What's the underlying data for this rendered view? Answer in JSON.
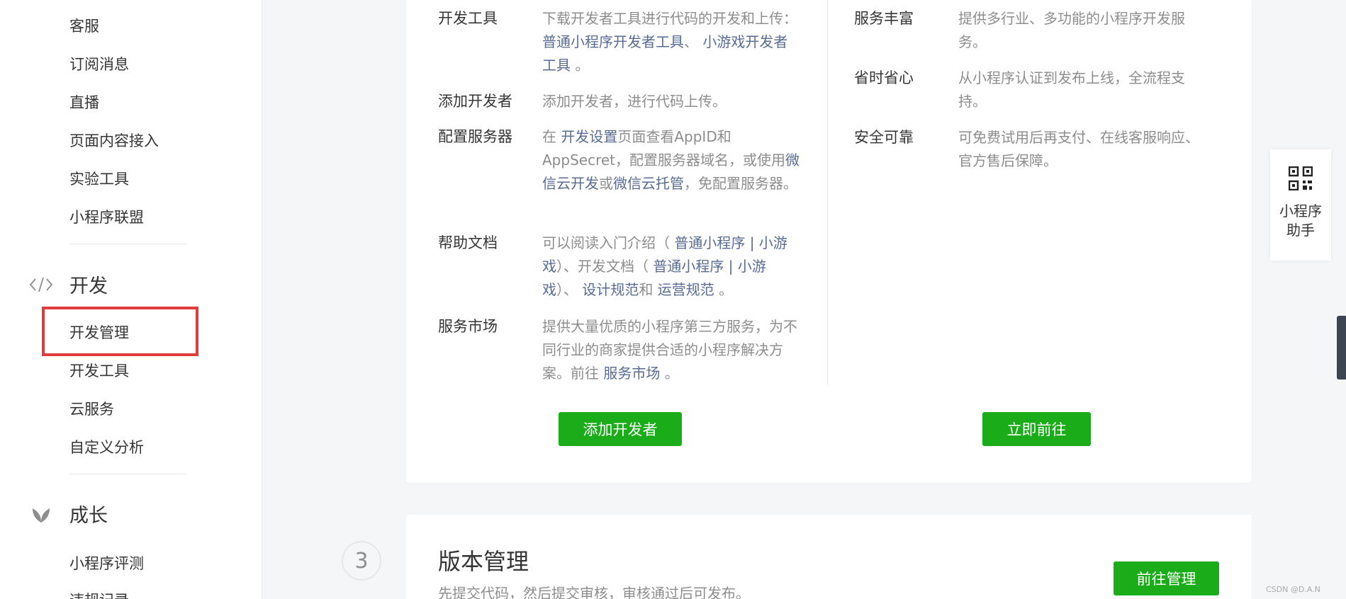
{
  "sidebar": {
    "items_top": [
      "客服",
      "订阅消息",
      "直播",
      "页面内容接入",
      "实验工具",
      "小程序联盟"
    ],
    "sections": [
      {
        "icon": "code-icon",
        "label": "开发",
        "items": [
          "开发管理",
          "开发工具",
          "云服务",
          "自定义分析"
        ]
      },
      {
        "icon": "leaf-icon",
        "label": "成长",
        "items": [
          "小程序评测",
          "违规记录"
        ]
      }
    ]
  },
  "left_rows": [
    {
      "label": "开发工具",
      "parts": [
        "下载开发者工具进行代码的开发和上传： ",
        "普通小程序开发者工具",
        "、 ",
        "小游戏开发者工具",
        " 。"
      ]
    },
    {
      "label": "添加开发者",
      "parts": [
        "添加开发者，进行代码上传。"
      ]
    },
    {
      "label": "配置服务器",
      "parts": [
        "在 ",
        "开发设置",
        "页面查看AppID和AppSecret，配置服务器域名，或使用",
        "微信云开发",
        "或",
        "微信云托管",
        "，免配置服务器。"
      ]
    },
    {
      "label": "帮助文档",
      "parts": [
        "可以阅读入门介绍（ ",
        "普通小程序 | 小游戏",
        "）、开发文档（ ",
        "普通小程序 | 小游戏",
        "）、 ",
        "设计规范",
        "和 ",
        "运营规范",
        " 。"
      ]
    },
    {
      "label": "服务市场",
      "parts": [
        "提供大量优质的小程序第三方服务，为不同行业的商家提供合适的小程序解决方案。前往 ",
        "服务市场",
        " 。"
      ]
    }
  ],
  "right_rows": [
    {
      "label": "服务丰富",
      "desc": "提供多行业、多功能的小程序开发服务。"
    },
    {
      "label": "省时省心",
      "desc": "从小程序认证到发布上线，全流程支持。"
    },
    {
      "label": "安全可靠",
      "desc": "可免费试用后再支付、在线客服响应、官方售后保障。"
    }
  ],
  "buttons": {
    "add_developer": "添加开发者",
    "go_now": "立即前往",
    "go_manage": "前往管理"
  },
  "version": {
    "step": "3",
    "title": "版本管理",
    "subtitle": "先提交代码，然后提交审核，审核通过后可发布。"
  },
  "assistant": {
    "label": "小程序助手"
  },
  "watermark": "CSDN @D.A.N",
  "colors": {
    "accent_green": "#1aad19",
    "link": "#576b95",
    "highlight": "#e23b3b"
  }
}
